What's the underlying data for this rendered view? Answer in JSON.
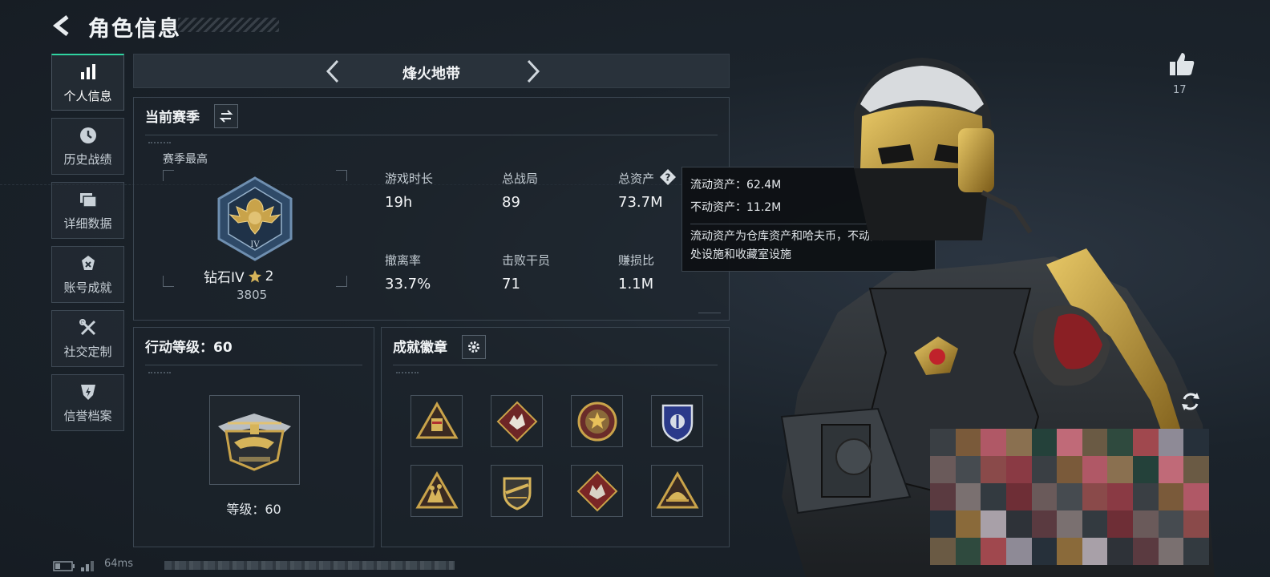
{
  "header": {
    "title": "角色信息",
    "back_icon": "chevron-left-icon"
  },
  "sidebar": {
    "items": [
      {
        "label": "个人信息",
        "icon": "bar-chart-icon",
        "active": true
      },
      {
        "label": "历史战绩",
        "icon": "clock-icon",
        "active": false
      },
      {
        "label": "详细数据",
        "icon": "folder-icon",
        "active": false
      },
      {
        "label": "账号成就",
        "icon": "trophy-icon",
        "active": false
      },
      {
        "label": "社交定制",
        "icon": "tools-icon",
        "active": false
      },
      {
        "label": "信誉档案",
        "icon": "shield-bolt-icon",
        "active": false
      }
    ]
  },
  "mode": {
    "title": "烽火地带"
  },
  "season": {
    "header": "当前赛季",
    "best_label": "赛季最高",
    "rank_name": "钻石IV",
    "rank_stars": "2",
    "rank_score": "3805",
    "stats": [
      {
        "label": "游戏时长",
        "value": "19h"
      },
      {
        "label": "总战局",
        "value": "89"
      },
      {
        "label": "总资产",
        "value": "73.7M"
      },
      {
        "label": "撤离率",
        "value": "33.7%"
      },
      {
        "label": "击败干员",
        "value": "71"
      },
      {
        "label": "赚损比",
        "value": "1.1M"
      }
    ]
  },
  "tooltip": {
    "liquid": "流动资产：62.4M",
    "fixed": "不动资产：11.2M",
    "note": "流动资产为仓库资产和哈夫币，不动资产为特勤处设施和收藏室设施"
  },
  "level": {
    "header": "行动等级：60",
    "text": "等级：60"
  },
  "achievements": {
    "header": "成就徽章",
    "badges": [
      "badge-tri-gold",
      "badge-diamond-red",
      "badge-star-round",
      "badge-blue-shield",
      "badge-tri-soldiers",
      "badge-shield-rifle",
      "badge-diamond-wolf",
      "badge-tri-helmet"
    ]
  },
  "likes": {
    "count": "17"
  },
  "footer": {
    "ping": "64ms"
  },
  "colors": {
    "accent": "#2fd3a0",
    "gold": "#c9a34a",
    "background": "#1a2129"
  }
}
